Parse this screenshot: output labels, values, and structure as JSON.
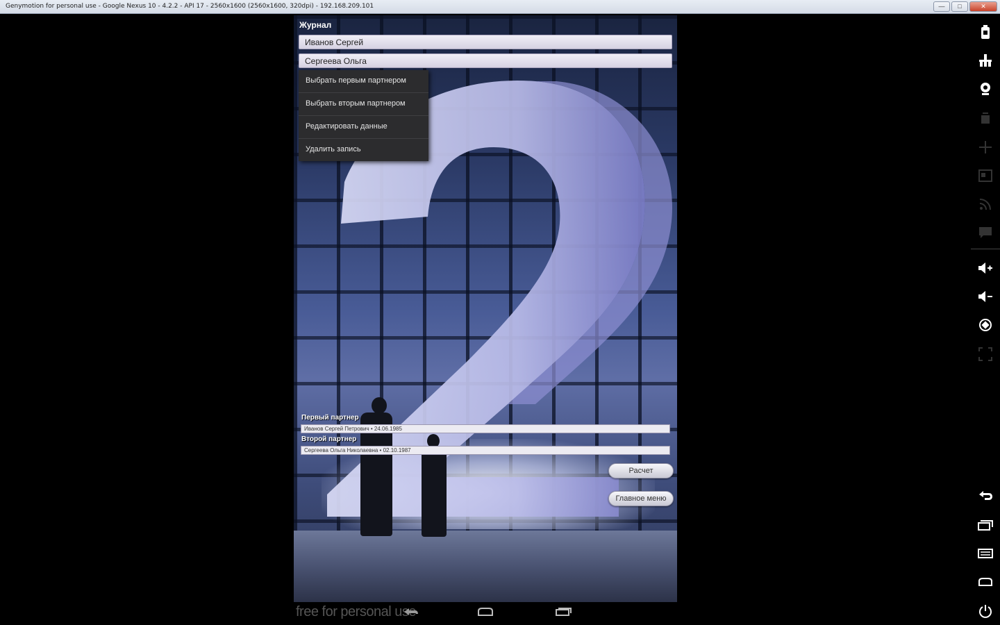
{
  "window": {
    "title": "Genymotion for personal use - Google Nexus 10 - 4.2.2 - API 17 - 2560x1600 (2560x1600, 320dpi) - 192.168.209.101",
    "minimize": "—",
    "maximize": "□",
    "close": "✕"
  },
  "app": {
    "action_title": "Журнал",
    "entries": [
      "Иванов Сергей",
      "Сергеева Ольга"
    ],
    "context_menu": [
      "Выбрать первым партнером",
      "Выбрать вторым партнером",
      "Редактировать данные",
      "Удалить запись"
    ],
    "first_partner_label": "Первый партнер",
    "first_partner_value": "Иванов Сергей Петрович • 24.06.1985",
    "second_partner_label": "Второй партнер",
    "second_partner_value": "Сергеева Ольга Николаевна • 02.10.1987",
    "calc_button": "Расчет",
    "main_menu_button": "Главное меню"
  },
  "footer": {
    "watermark": "free for personal use"
  },
  "sidebar_icons": [
    "battery-icon",
    "gps-icon",
    "webcam-icon",
    "remote-control-icon",
    "move-icon",
    "id-icon",
    "rss-icon",
    "sms-icon",
    "volume-up-icon",
    "volume-down-icon",
    "rotate-icon",
    "scale-icon",
    "back-icon",
    "recent-apps-icon",
    "menu-icon",
    "home-icon",
    "power-icon"
  ]
}
